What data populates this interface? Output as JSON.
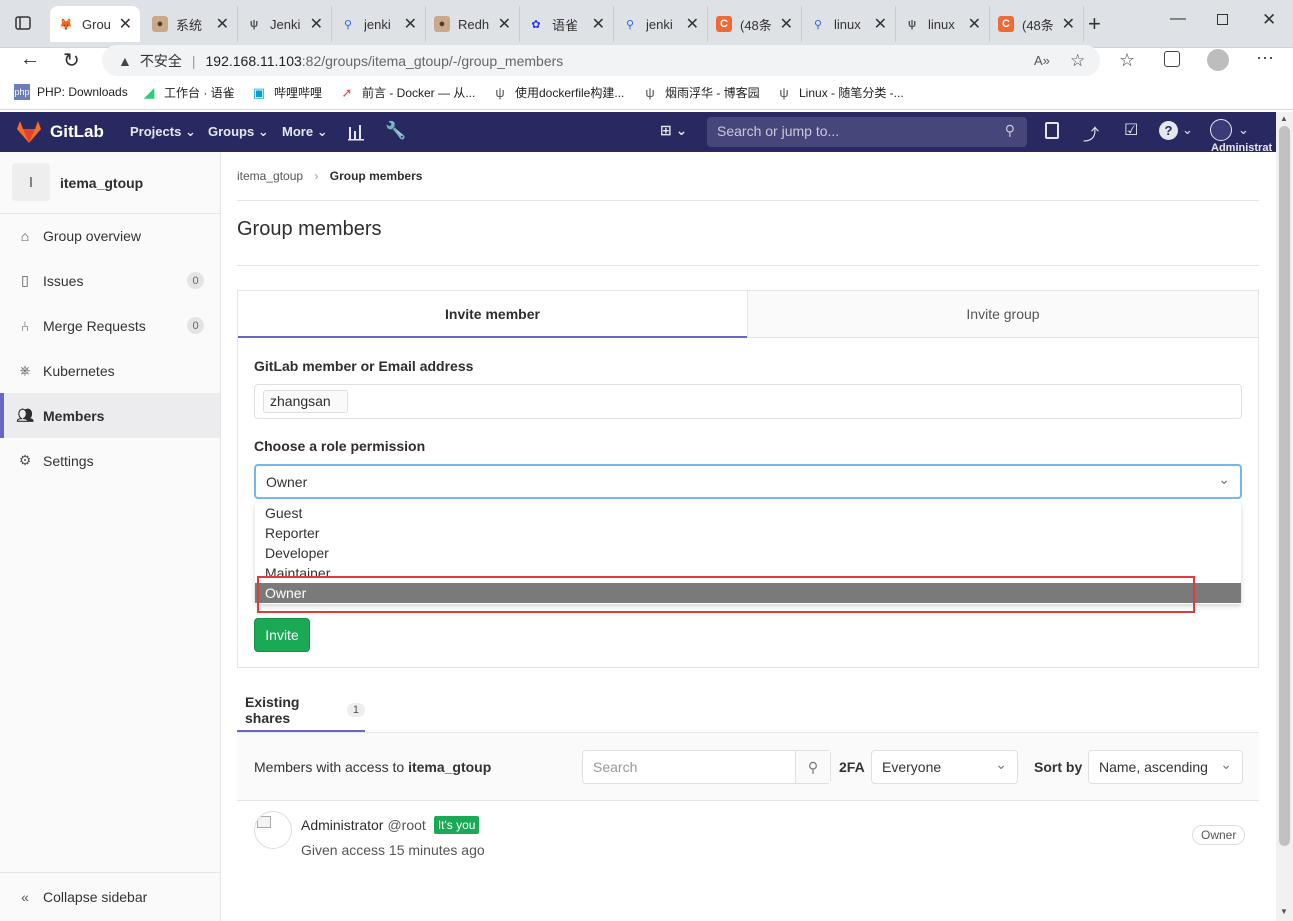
{
  "browser": {
    "tabs": [
      {
        "title": "Grou",
        "icon": "gitlab-icon"
      },
      {
        "title": "系统",
        "icon": "avatar-icon"
      },
      {
        "title": "Jenki",
        "icon": "jenkins-icon"
      },
      {
        "title": "jenki",
        "icon": "search-icon"
      },
      {
        "title": "Redh",
        "icon": "avatar-icon"
      },
      {
        "title": "语雀",
        "icon": "baidu-icon"
      },
      {
        "title": "jenki",
        "icon": "search-icon"
      },
      {
        "title": "(48条",
        "icon": "c-icon"
      },
      {
        "title": "linux",
        "icon": "search-icon"
      },
      {
        "title": "linux",
        "icon": "jenkins-icon"
      },
      {
        "title": "(48条",
        "icon": "c-icon"
      }
    ],
    "security_label": "不安全",
    "url_host": "192.168.11.103",
    "url_rest": ":82/groups/itema_gtoup/-/group_members",
    "bookmarks": [
      {
        "label": "PHP: Downloads"
      },
      {
        "label": "工作台 · 语雀"
      },
      {
        "label": "哔哩哔哩"
      },
      {
        "label": "前言 - Docker — 从..."
      },
      {
        "label": "使用dockerfile构建..."
      },
      {
        "label": "烟雨浮华 - 博客园"
      },
      {
        "label": "Linux - 随笔分类 -..."
      }
    ]
  },
  "header": {
    "brand": "GitLab",
    "nav": {
      "projects": "Projects",
      "groups": "Groups",
      "more": "More"
    },
    "search_placeholder": "Search or jump to...",
    "user_label": "Administrat"
  },
  "sidebar": {
    "group_initial": "I",
    "group_name": "itema_gtoup",
    "items": [
      {
        "label": "Group overview"
      },
      {
        "label": "Issues",
        "badge": "0"
      },
      {
        "label": "Merge Requests",
        "badge": "0"
      },
      {
        "label": "Kubernetes"
      },
      {
        "label": "Members"
      },
      {
        "label": "Settings"
      }
    ],
    "collapse_label": "Collapse sidebar"
  },
  "breadcrumb": {
    "group": "itema_gtoup",
    "current": "Group members"
  },
  "page_title": "Group members",
  "invite": {
    "tabs": {
      "member": "Invite member",
      "group": "Invite group"
    },
    "member_label": "GitLab member or Email address",
    "member_token": "zhangsan",
    "role_label": "Choose a role permission",
    "role_selected": "Owner",
    "role_options": [
      "Guest",
      "Reporter",
      "Developer",
      "Maintainer",
      "Owner"
    ],
    "invite_button": "Invite"
  },
  "existing": {
    "tab_label": "Existing shares",
    "tab_count": "1",
    "members_with_access": "Members with access to",
    "group_name": "itema_gtoup",
    "search_placeholder": "Search",
    "twofa_label": "2FA",
    "twofa_value": "Everyone",
    "sort_label": "Sort by",
    "sort_value": "Name, ascending"
  },
  "member": {
    "name": "Administrator",
    "handle": "@root",
    "you_badge": "It's you",
    "access": "Given access 15 minutes ago",
    "role": "Owner"
  },
  "colors": {
    "header": "#292961",
    "accent": "#6666c4",
    "green": "#1aaa55",
    "highlight_box": "#e03a3a"
  }
}
